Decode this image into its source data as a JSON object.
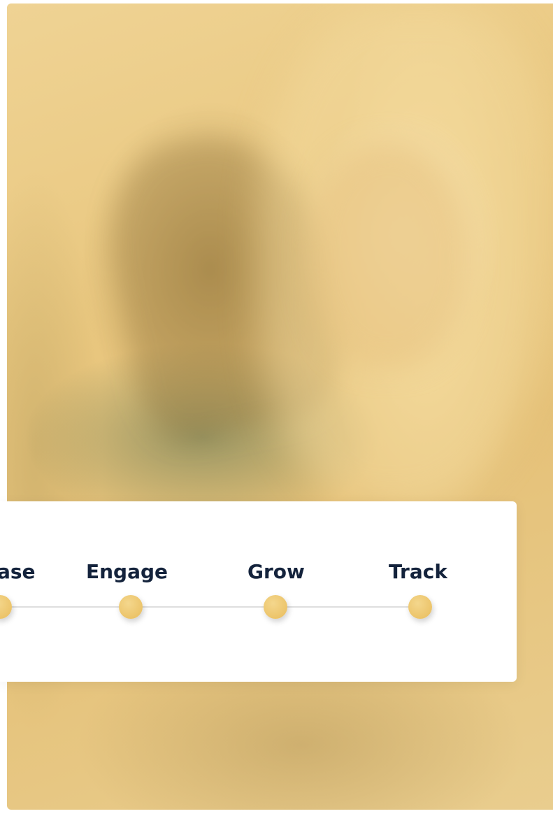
{
  "timeline": {
    "steps": [
      {
        "label": "ase"
      },
      {
        "label": "Engage"
      },
      {
        "label": "Grow"
      },
      {
        "label": "Track"
      }
    ]
  },
  "colors": {
    "card_background": "#ffffff",
    "label_text": "#14233c",
    "dot_gold": "#ecc46a",
    "line_gray": "#dedede",
    "hero_overlay": "#e9c77f"
  },
  "hero": {
    "icon": "photo-of-woman-icon"
  }
}
